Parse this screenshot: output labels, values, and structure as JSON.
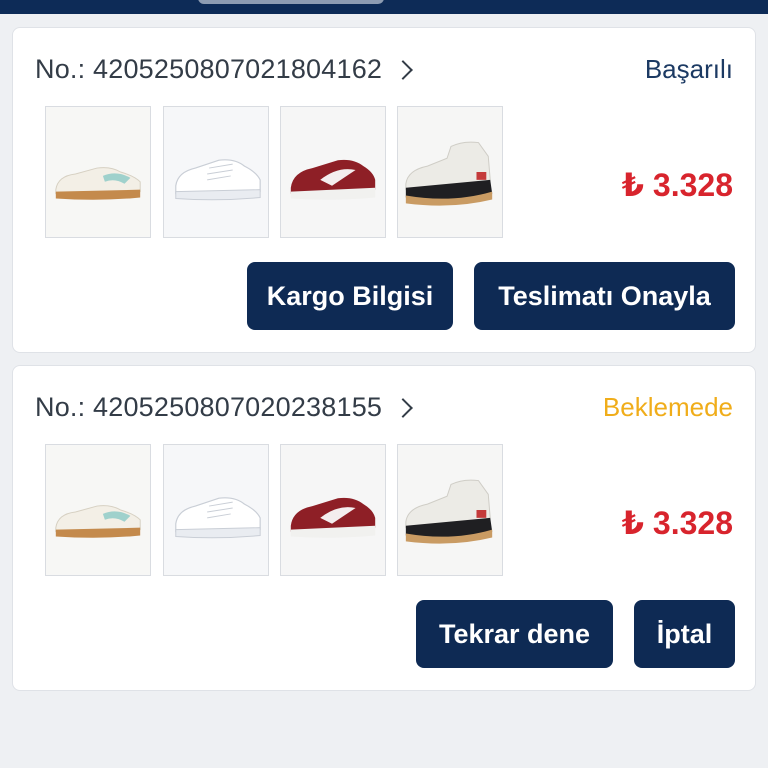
{
  "orders": [
    {
      "number_label": "No.: 4205250807021804162",
      "status": "Başarılı",
      "status_color": "#1c3a63",
      "price": "₺ 3.328",
      "buttons": [
        "Kargo Bilgisi",
        "Teslimatı Onayla"
      ],
      "items": [
        "sneaker-white-mint",
        "sneaker-white",
        "sneaker-burgundy",
        "boot-cream-black"
      ]
    },
    {
      "number_label": "No.: 4205250807020238155",
      "status": "Beklemede",
      "status_color": "#f0ad1a",
      "price": "₺ 3.328",
      "buttons": [
        "Tekrar dene",
        "İptal"
      ],
      "items": [
        "sneaker-white-mint",
        "sneaker-white",
        "sneaker-burgundy",
        "boot-cream-black"
      ]
    }
  ],
  "colors": {
    "header": "#0d2b57",
    "button": "#0e2a54",
    "price": "#d8242d"
  }
}
